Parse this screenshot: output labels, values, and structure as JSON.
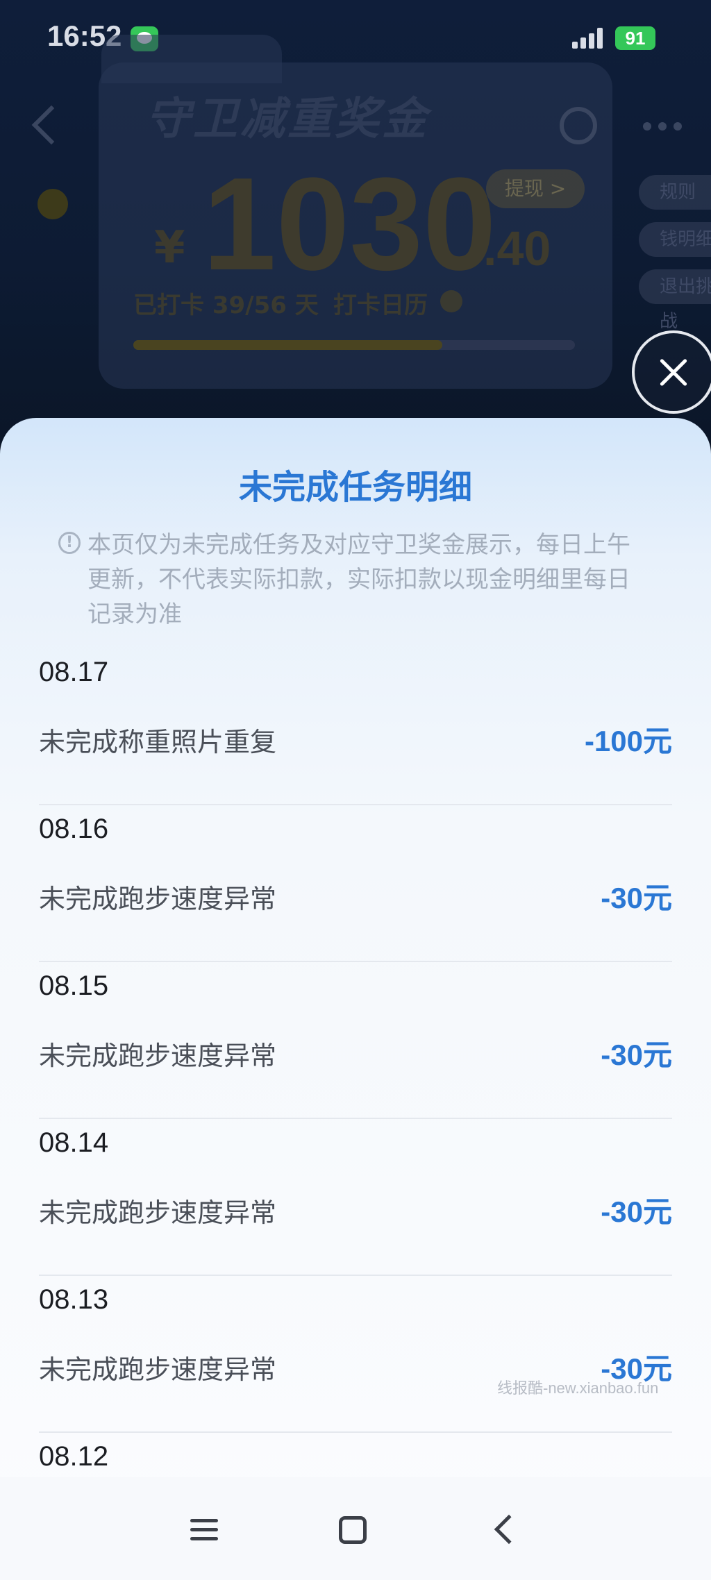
{
  "status_bar": {
    "time": "16:52",
    "battery": "91"
  },
  "background_page": {
    "prize_title": "守卫减重奖金",
    "currency_symbol": "¥",
    "amount_integer": "1030",
    "amount_decimal": ".40",
    "withdraw_label": "提现 >",
    "checkin_progress": "已打卡 39/56 天",
    "calendar_link": "打卡日历",
    "progress_fraction": 0.7,
    "side_pills": [
      "规则",
      "钱明细",
      "退出挑战"
    ]
  },
  "sheet": {
    "title": "未完成任务明细",
    "notice": "本页仅为未完成任务及对应守卫奖金展示，每日上午更新，不代表实际扣款，实际扣款以现金明细里每日记录为准",
    "records": [
      {
        "date": "08.17",
        "description": "未完成称重照片重复",
        "amount": "-100元"
      },
      {
        "date": "08.16",
        "description": "未完成跑步速度异常",
        "amount": "-30元"
      },
      {
        "date": "08.15",
        "description": "未完成跑步速度异常",
        "amount": "-30元"
      },
      {
        "date": "08.14",
        "description": "未完成跑步速度异常",
        "amount": "-30元"
      },
      {
        "date": "08.13",
        "description": "未完成跑步速度异常",
        "amount": "-30元"
      },
      {
        "date": "08.12",
        "description": "",
        "amount": ""
      }
    ]
  },
  "watermark": "线报酷-new.xianbao.fun",
  "colors": {
    "accent": "#2a77d4",
    "sheet_top": "#d3e6fa",
    "text_primary": "#1b1d22",
    "text_secondary": "#4a4f58",
    "notice_text": "#a3adbb"
  },
  "icons": {
    "back": "chevron-left-icon",
    "more": "more-dots-icon",
    "share": "share-icon",
    "close": "close-icon",
    "notice": "info-icon",
    "nav_menu": "menu-icon",
    "nav_home": "home-icon",
    "nav_back": "back-icon"
  }
}
